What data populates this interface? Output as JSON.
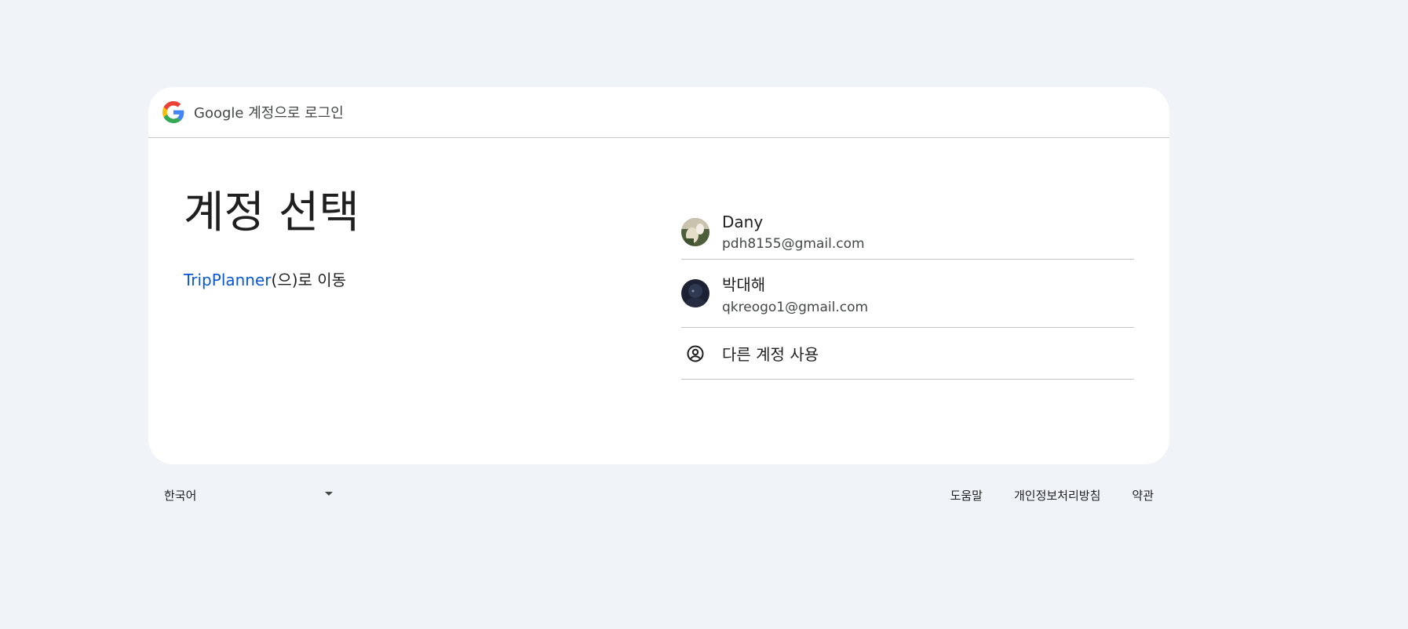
{
  "header": {
    "brand": "Google",
    "text": "계정으로 로그인"
  },
  "main": {
    "title": "계정 선택",
    "app_name": "TripPlanner",
    "continue_suffix": "(으)로 이동"
  },
  "accounts": [
    {
      "name": "Dany",
      "email": "pdh8155@gmail.com",
      "avatar": "photo-avatar"
    },
    {
      "name": "박대해",
      "email": "qkreogo1@gmail.com",
      "avatar": "photo-avatar"
    }
  ],
  "other_account": {
    "label": "다른 계정 사용",
    "icon": "account-circle-icon"
  },
  "footer": {
    "language": "한국어",
    "links": [
      "도움말",
      "개인정보처리방침",
      "약관"
    ]
  },
  "colors": {
    "background": "#f0f4f9",
    "link": "#0b57d0",
    "divider": "#c4c7c5"
  }
}
